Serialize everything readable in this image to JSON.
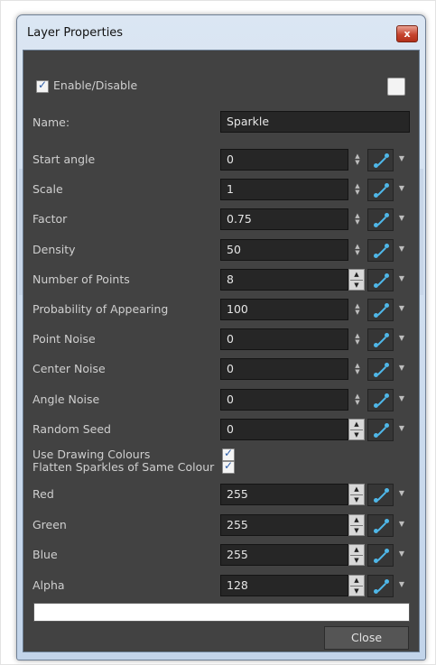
{
  "window": {
    "title": "Layer Properties",
    "close_glyph": "x"
  },
  "enable": {
    "label": "Enable/Disable",
    "checked": true
  },
  "name_field": {
    "label": "Name:",
    "value": "Sparkle"
  },
  "params": [
    {
      "label": "Start angle",
      "value": "0",
      "spinner": "small"
    },
    {
      "label": "Scale",
      "value": "1",
      "spinner": "small"
    },
    {
      "label": "Factor",
      "value": "0.75",
      "spinner": "small"
    },
    {
      "label": "Density",
      "value": "50",
      "spinner": "small"
    },
    {
      "label": "Number of Points",
      "value": "8",
      "spinner": "box"
    },
    {
      "label": "Probability of Appearing",
      "value": "100",
      "spinner": "small"
    },
    {
      "label": "Point Noise",
      "value": "0",
      "spinner": "small"
    },
    {
      "label": "Center Noise",
      "value": "0",
      "spinner": "small"
    },
    {
      "label": "Angle Noise",
      "value": "0",
      "spinner": "small"
    },
    {
      "label": "Random Seed",
      "value": "0",
      "spinner": "box"
    }
  ],
  "checkboxes": [
    {
      "label": "Use Drawing Colours",
      "checked": true
    },
    {
      "label": "Flatten Sparkles of Same Colour",
      "checked": true
    }
  ],
  "colors": [
    {
      "label": "Red",
      "value": "255"
    },
    {
      "label": "Green",
      "value": "255"
    },
    {
      "label": "Blue",
      "value": "255"
    },
    {
      "label": "Alpha",
      "value": "128"
    }
  ],
  "swatch_color": "#ffffff",
  "close_button": "Close",
  "icons": {
    "function": "function-curve-icon",
    "dropdown": "chevron-down-icon",
    "spinner": "up-down-arrows-icon",
    "check": "checkmark-icon"
  }
}
